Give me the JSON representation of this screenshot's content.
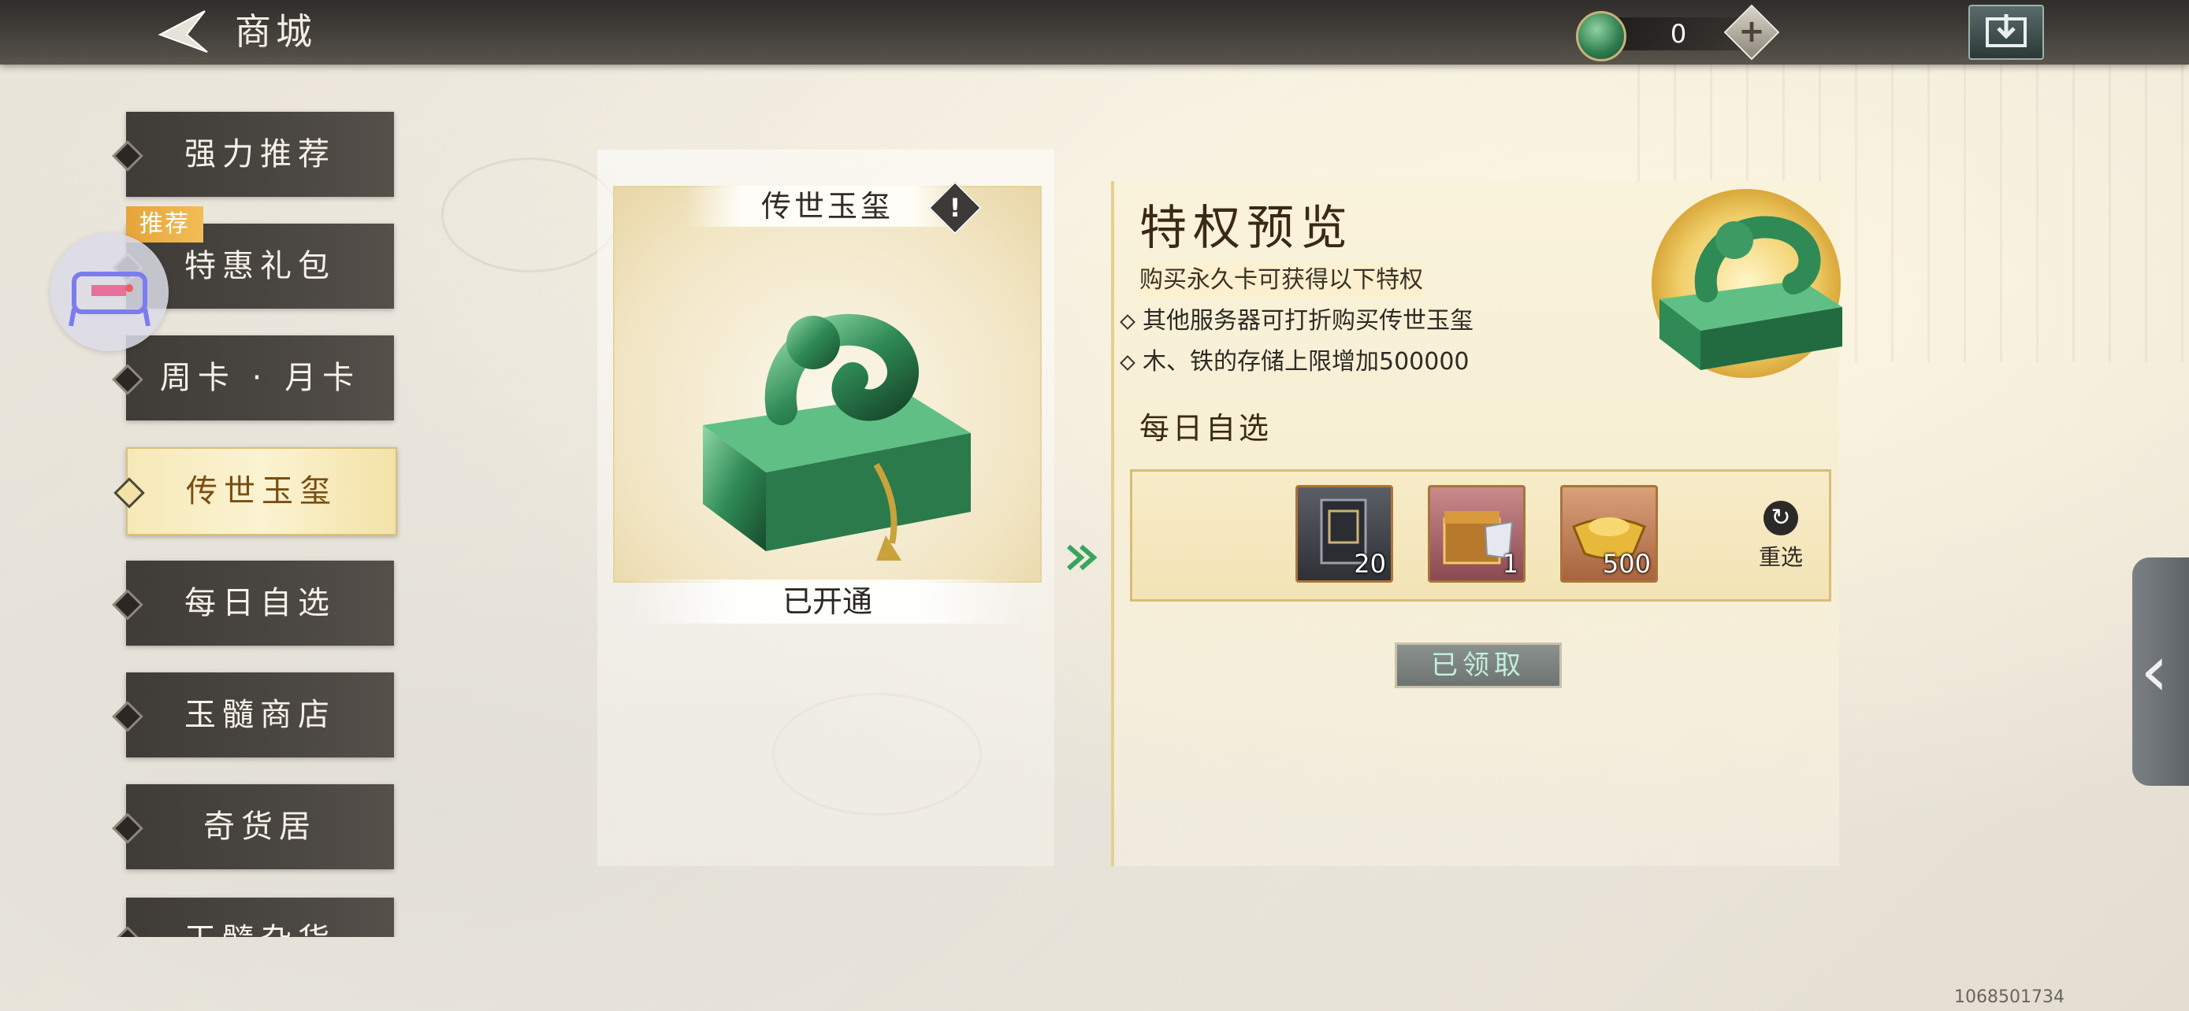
{
  "header": {
    "title": "商城",
    "currency_value": "0"
  },
  "sidebar": {
    "badge": "推荐",
    "items": [
      {
        "label": "强力推荐"
      },
      {
        "label": "特惠礼包"
      },
      {
        "label": "周卡 · 月卡"
      },
      {
        "label": "传世玉玺"
      },
      {
        "label": "每日自选"
      },
      {
        "label": "玉髓商店"
      },
      {
        "label": "奇货居"
      },
      {
        "label": "玉髓杂货"
      }
    ],
    "active_index": 3
  },
  "item_card": {
    "name": "传世玉玺",
    "status": "已开通"
  },
  "privileges": {
    "title": "特权预览",
    "subtitle": "购买永久卡可获得以下特权",
    "lines": [
      "其他服务器可打折购买传世玉玺",
      "木、铁的存储上限增加500000"
    ]
  },
  "daily": {
    "title": "每日自选",
    "rewards": [
      {
        "icon": "scroll-book-icon",
        "qty": "20"
      },
      {
        "icon": "treasure-chest-icon",
        "qty": "1"
      },
      {
        "icon": "gold-ingot-icon",
        "qty": "500"
      }
    ],
    "reselect_label": "重选",
    "claimed_label": "已领取"
  },
  "footer": {
    "uid": "1068501734"
  },
  "colors": {
    "active_tab": "#f6e9b8",
    "jade": "#2f8a55",
    "gold": "#d9bd78"
  }
}
